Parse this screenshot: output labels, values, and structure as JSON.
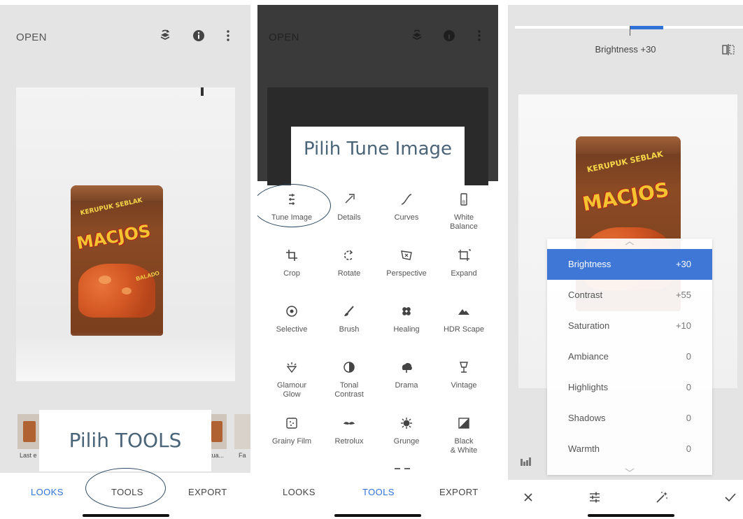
{
  "panel1": {
    "open_label": "OPEN",
    "icons": [
      "layers-undo-icon",
      "info-icon",
      "more-vertical-icon"
    ],
    "product": {
      "brand_top": "KERUPUK SEBLAK",
      "brand_main": "MACJOS",
      "variant": "BALADO"
    },
    "thumbnails": [
      {
        "caption": "Last e"
      },
      {
        "caption": "tua..."
      },
      {
        "caption": "Fa"
      }
    ],
    "callout": "Pilih TOOLS",
    "nav": {
      "looks": "LOOKS",
      "tools": "TOOLS",
      "export": "EXPORT"
    }
  },
  "panel2": {
    "open_label": "OPEN",
    "callout": "Pilih Tune Image",
    "tools": [
      {
        "label": "Tune Image",
        "icon": "tune-image-icon"
      },
      {
        "label": "Details",
        "icon": "details-icon"
      },
      {
        "label": "Curves",
        "icon": "curves-icon"
      },
      {
        "label": "White\nBalance",
        "icon": "white-balance-icon"
      },
      {
        "label": "Crop",
        "icon": "crop-icon"
      },
      {
        "label": "Rotate",
        "icon": "rotate-icon"
      },
      {
        "label": "Perspective",
        "icon": "perspective-icon"
      },
      {
        "label": "Expand",
        "icon": "expand-icon"
      },
      {
        "label": "Selective",
        "icon": "selective-icon"
      },
      {
        "label": "Brush",
        "icon": "brush-icon"
      },
      {
        "label": "Healing",
        "icon": "healing-icon"
      },
      {
        "label": "HDR Scape",
        "icon": "hdr-scape-icon"
      },
      {
        "label": "Glamour\nGlow",
        "icon": "glamour-glow-icon"
      },
      {
        "label": "Tonal\nContrast",
        "icon": "tonal-contrast-icon"
      },
      {
        "label": "Drama",
        "icon": "drama-icon"
      },
      {
        "label": "Vintage",
        "icon": "vintage-icon"
      },
      {
        "label": "Grainy Film",
        "icon": "grainy-film-icon"
      },
      {
        "label": "Retrolux",
        "icon": "retrolux-icon"
      },
      {
        "label": "Grunge",
        "icon": "grunge-icon"
      },
      {
        "label": "Black\n& White",
        "icon": "black-white-icon"
      }
    ],
    "nav": {
      "looks": "LOOKS",
      "tools": "TOOLS",
      "export": "EXPORT"
    }
  },
  "panel3": {
    "title": "Brightness +30",
    "slider_level": 0.3,
    "adjustments": [
      {
        "name": "Brightness",
        "value": "+30",
        "selected": true
      },
      {
        "name": "Contrast",
        "value": "+55",
        "selected": false
      },
      {
        "name": "Saturation",
        "value": "+10",
        "selected": false
      },
      {
        "name": "Ambiance",
        "value": "0",
        "selected": false
      },
      {
        "name": "Highlights",
        "value": "0",
        "selected": false
      },
      {
        "name": "Shadows",
        "value": "0",
        "selected": false
      },
      {
        "name": "Warmth",
        "value": "0",
        "selected": false
      }
    ],
    "bottom_icons": [
      "close-icon",
      "adjust-sliders-icon",
      "auto-wand-icon",
      "checkmark-icon"
    ]
  },
  "colors": {
    "accent": "#2f73d9",
    "selected_row": "#3e77d6",
    "callout_text": "#4a6478",
    "ellipse": "#2e4a63"
  }
}
